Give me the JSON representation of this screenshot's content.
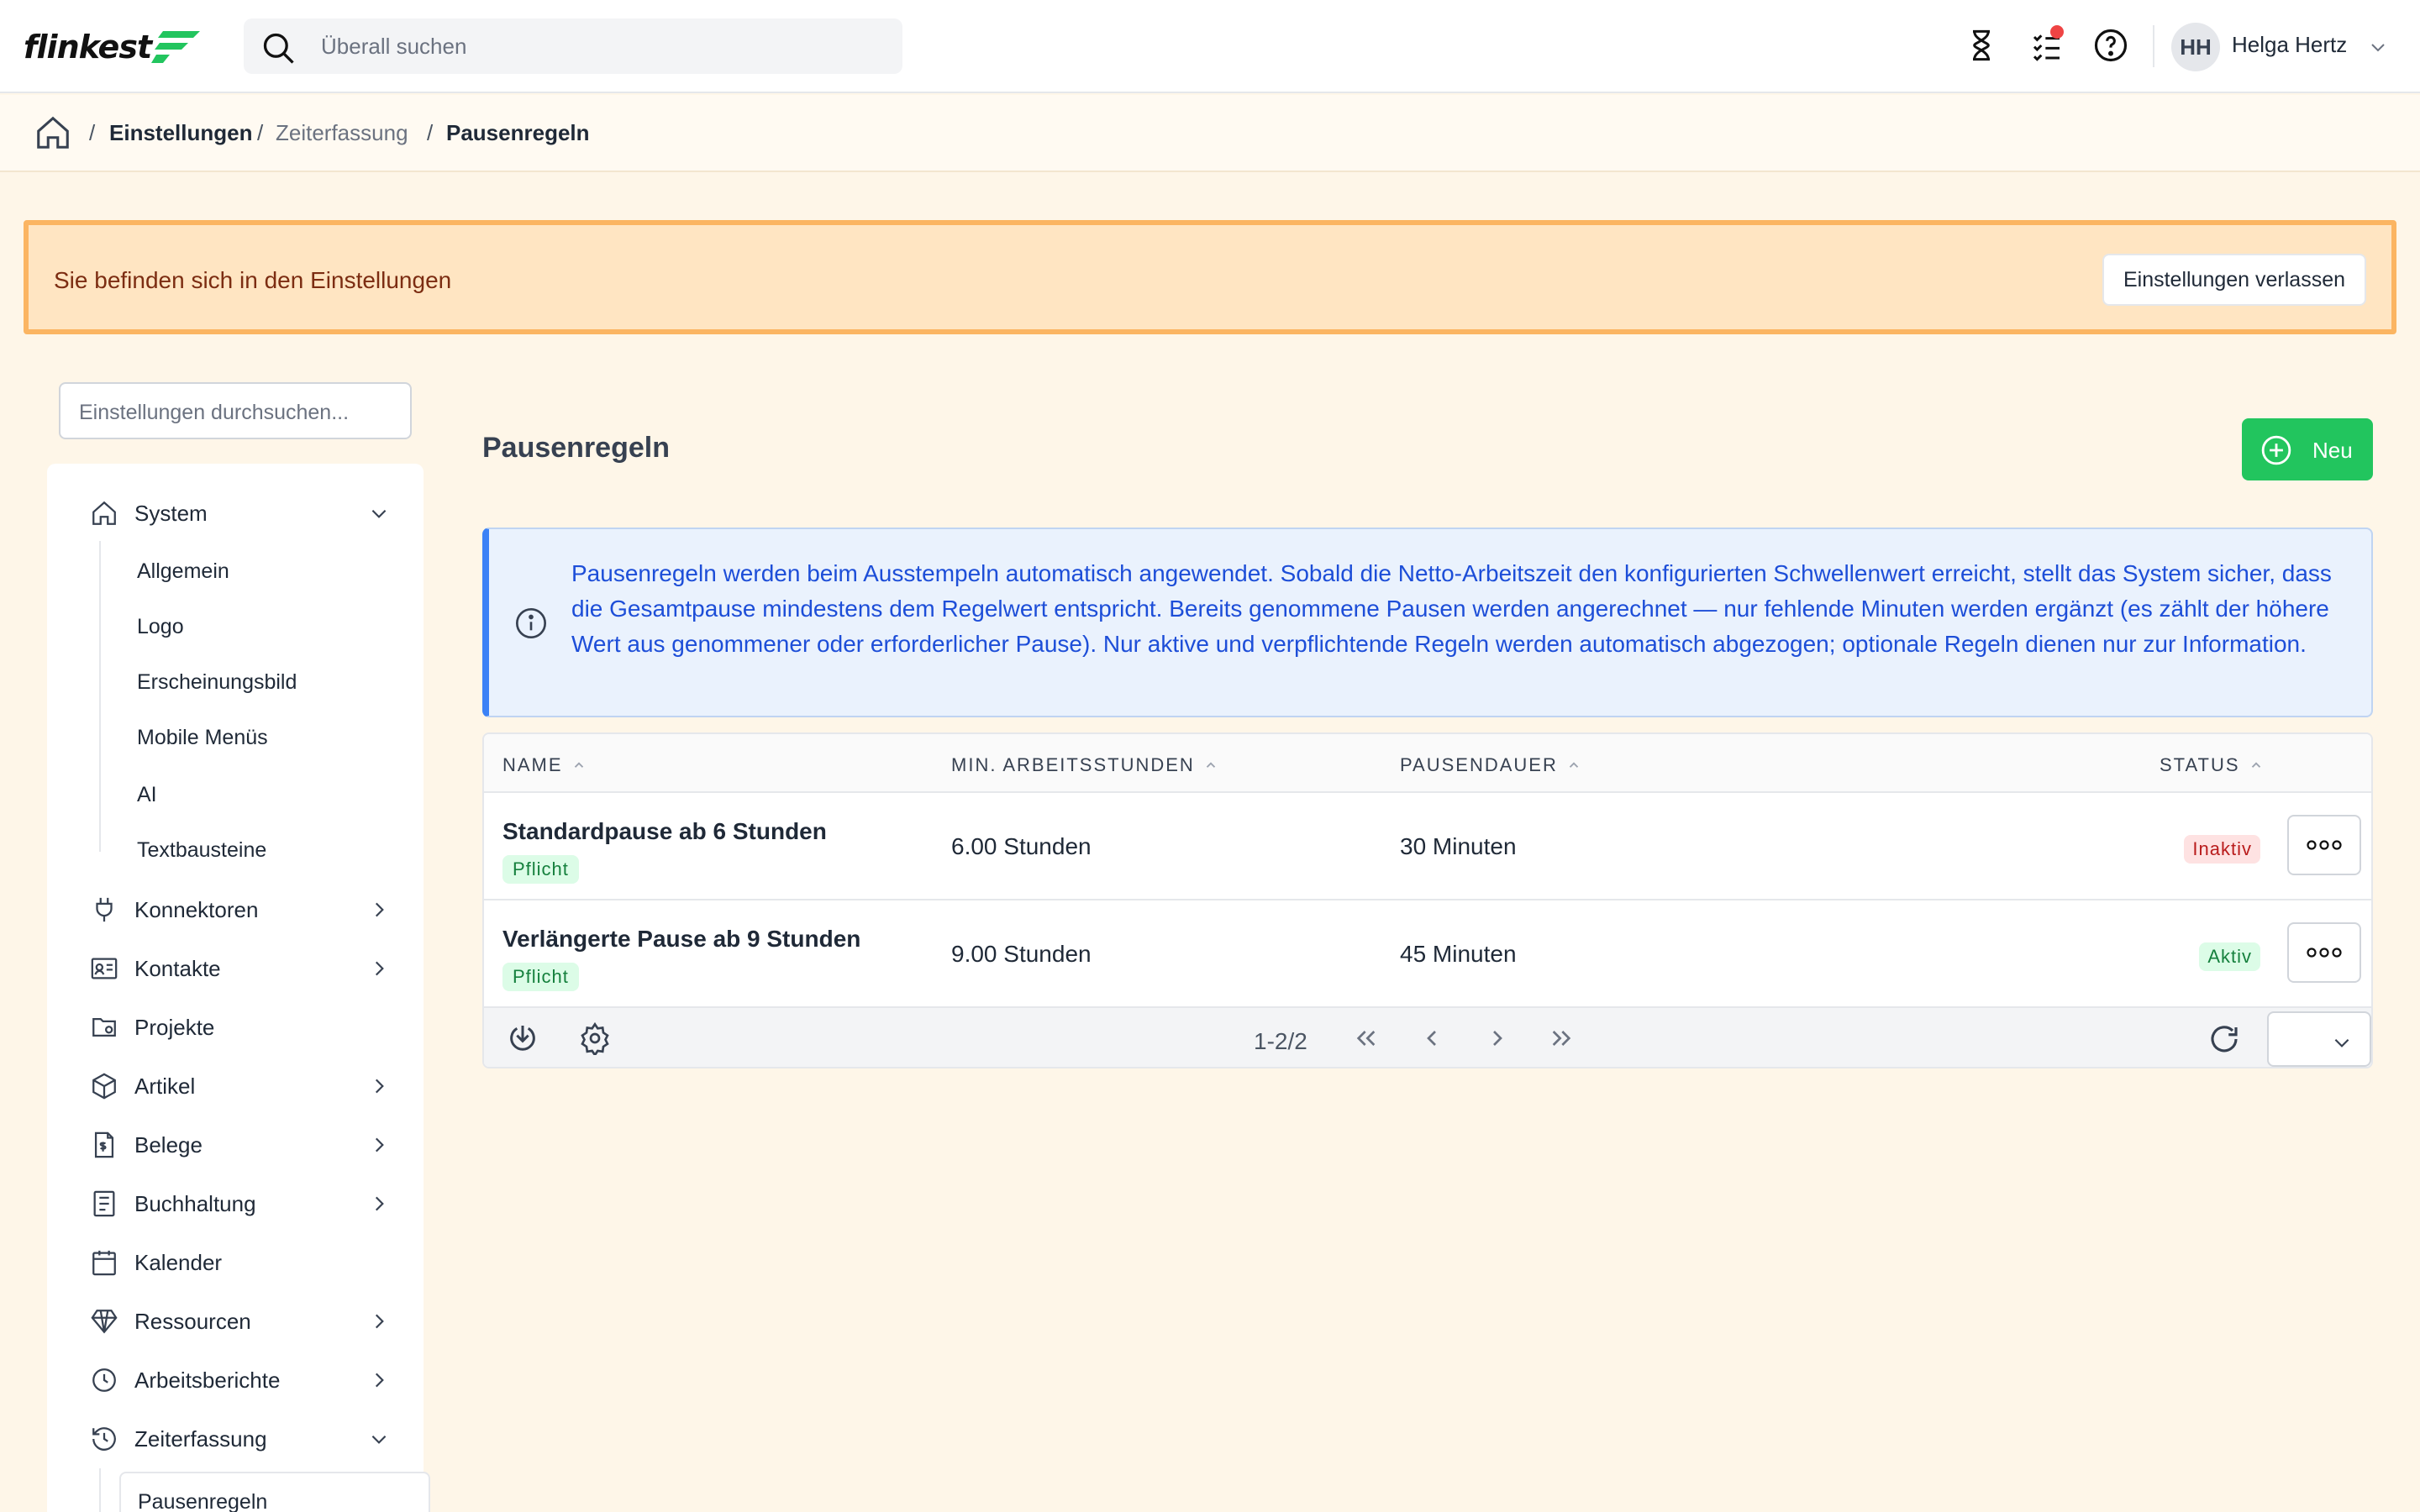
{
  "header": {
    "logo": "flinkest",
    "search_placeholder": "Überall suchen",
    "user_initials": "HH",
    "user_name": "Helga Hertz"
  },
  "breadcrumb": {
    "items": [
      "Einstellungen",
      "Zeiterfassung",
      "Pausenregeln"
    ]
  },
  "banner": {
    "text": "Sie befinden sich in den Einstellungen",
    "button": "Einstellungen verlassen"
  },
  "sidebar": {
    "search_placeholder": "Einstellungen durchsuchen...",
    "system": {
      "label": "System",
      "children": [
        "Allgemein",
        "Logo",
        "Erscheinungsbild",
        "Mobile Menüs",
        "AI",
        "Textbausteine"
      ]
    },
    "items": [
      "Konnektoren",
      "Kontakte",
      "Projekte",
      "Artikel",
      "Belege",
      "Buchhaltung",
      "Kalender",
      "Ressourcen",
      "Arbeitsberichte",
      "Zeiterfassung"
    ],
    "active_child": "Pausenregeln"
  },
  "main": {
    "title": "Pausenregeln",
    "new_button": "Neu",
    "info_text": "Pausenregeln werden beim Ausstempeln automatisch angewendet. Sobald die Netto-Arbeitszeit den konfigurierten Schwellenwert erreicht, stellt das System sicher, dass die Gesamtpause mindestens dem Regelwert entspricht. Bereits genommene Pausen werden angerechnet — nur fehlende Minuten werden ergänzt (es zählt der höhere Wert aus genommener oder erforderlicher Pause). Nur aktive und verpflichtende Regeln werden automatisch abgezogen; optionale Regeln dienen nur zur Information.",
    "table": {
      "columns": [
        "NAME",
        "MIN. ARBEITSSTUNDEN",
        "PAUSENDAUER",
        "STATUS"
      ],
      "rows": [
        {
          "name": "Standardpause ab 6 Stunden",
          "type": "Pflicht",
          "hours": "6.00 Stunden",
          "duration": "30 Minuten",
          "status": "Inaktiv"
        },
        {
          "name": "Verlängerte Pause ab 9 Stunden",
          "type": "Pflicht",
          "hours": "9.00 Stunden",
          "duration": "45 Minuten",
          "status": "Aktiv"
        }
      ],
      "pager": "1-2/2"
    }
  }
}
